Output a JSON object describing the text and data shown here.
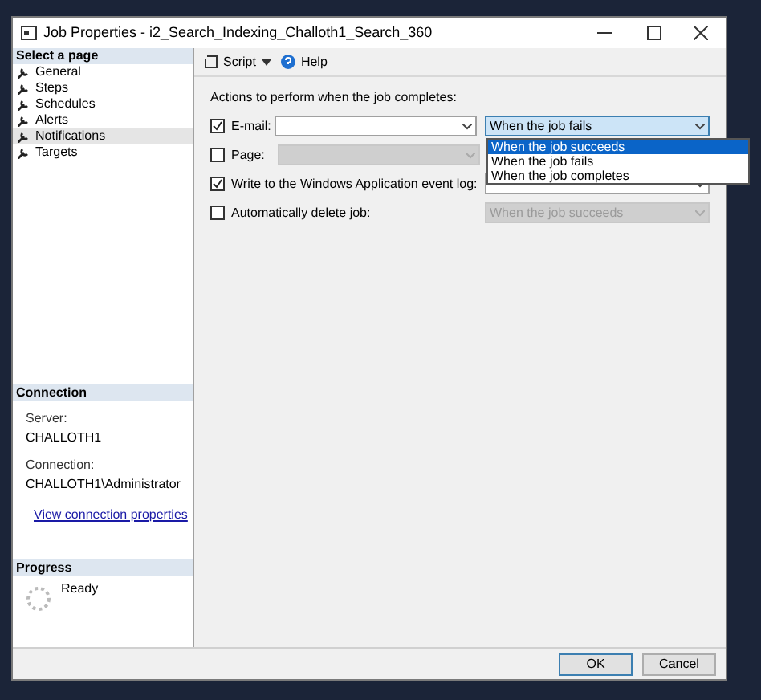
{
  "window": {
    "title": "Job Properties - i2_Search_Indexing_Challoth1_Search_360"
  },
  "sidebar": {
    "header": "Select a page",
    "items": [
      {
        "label": "General",
        "selected": false
      },
      {
        "label": "Steps",
        "selected": false
      },
      {
        "label": "Schedules",
        "selected": false
      },
      {
        "label": "Alerts",
        "selected": false
      },
      {
        "label": "Notifications",
        "selected": true
      },
      {
        "label": "Targets",
        "selected": false
      }
    ]
  },
  "connection": {
    "header": "Connection",
    "server_label": "Server:",
    "server": "CHALLOTH1",
    "connection_label": "Connection:",
    "connection": "CHALLOTH1\\Administrator",
    "link": "View connection properties"
  },
  "progress": {
    "header": "Progress",
    "status": "Ready"
  },
  "toolbar": {
    "script": "Script",
    "help": "Help"
  },
  "actions_heading": "Actions to perform when the job completes:",
  "actions": [
    {
      "kind": "operator",
      "label": "E-mail:",
      "checked": true,
      "operator_disabled": false,
      "condition": "When the job fails",
      "condition_disabled": false
    },
    {
      "kind": "operator",
      "label": "Page:",
      "checked": false,
      "operator_disabled": true
    },
    {
      "kind": "simple",
      "label": "Write to the Windows Application event log:",
      "checked": true,
      "condition_disabled": false
    },
    {
      "kind": "simple",
      "label": "Automatically delete job:",
      "checked": false,
      "condition": "When the job succeeds",
      "condition_disabled": true
    }
  ],
  "dropdown": [
    {
      "label": "When the job succeeds",
      "selected": true
    },
    {
      "label": "When the job fails",
      "selected": false
    },
    {
      "label": "When the job completes",
      "selected": false
    }
  ],
  "buttons": [
    "OK",
    "Cancel"
  ]
}
